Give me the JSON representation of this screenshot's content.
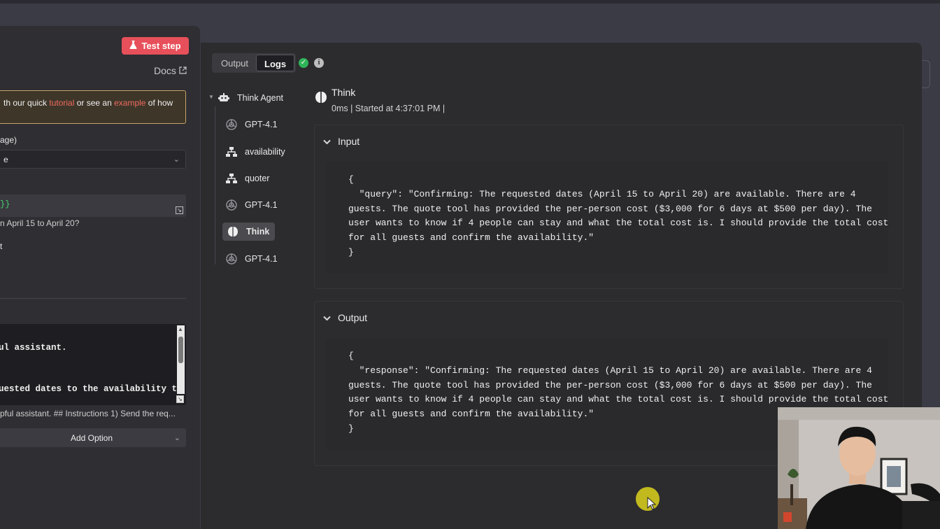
{
  "left_panel": {
    "test_step_label": "Test step",
    "docs_label": "Docs",
    "tip": {
      "prefix": "th our quick ",
      "link1": "tutorial",
      "middle": " or see an ",
      "link2": "example",
      "suffix": " of how"
    },
    "field_label_1": "age)",
    "select_value": "e",
    "variable_value": "}}",
    "variable_preview": "n April 15 to April 20?",
    "field_label_2": "t",
    "prompt_lines": [
      "ul assistant.",
      "uested dates to the availability to"
    ],
    "prompt_preview": "pful assistant. ## Instructions 1) Send the req...",
    "add_option_label": "Add Option"
  },
  "logs": {
    "tabs": [
      {
        "label": "Output",
        "active": false
      },
      {
        "label": "Logs",
        "active": true
      }
    ],
    "tree": {
      "root": {
        "label": "Think Agent",
        "icon": "robot-icon"
      },
      "children": [
        {
          "label": "GPT-4.1",
          "icon": "openai-icon",
          "selected": false
        },
        {
          "label": "availability",
          "icon": "network-icon",
          "selected": false
        },
        {
          "label": "quoter",
          "icon": "network-icon",
          "selected": false
        },
        {
          "label": "GPT-4.1",
          "icon": "openai-icon",
          "selected": false
        },
        {
          "label": "Think",
          "icon": "brain-icon",
          "selected": true
        },
        {
          "label": "GPT-4.1",
          "icon": "openai-icon",
          "selected": false
        }
      ]
    },
    "detail": {
      "title": "Think",
      "meta": "0ms | Started at 4:37:01 PM |",
      "input_label": "Input",
      "input_code": "{\n  \"query\": \"Confirming: The requested dates (April 15 to April 20) are available. There are 4\nguests. The quote tool has provided the per-person cost ($3,000 for 6 days at $500 per day). The\nuser wants to know if 4 people can stay and what the total cost is. I should provide the total cost\nfor all guests and confirm the availability.\"\n}",
      "output_label": "Output",
      "output_code": "{\n  \"response\": \"Confirming: The requested dates (April 15 to April 20) are available. There are 4\nguests. The quote tool has provided the per-person cost ($3,000 for 6 days at $500 per day). The\nuser wants to know if 4 people can stay and what the total cost is. I should provide the total cost\nfor all guests and confirm the availability.\"\n}"
    }
  },
  "colors": {
    "accent_red": "#e7505a",
    "success_green": "#2fb457",
    "cursor_highlight": "#d7cd1e"
  }
}
